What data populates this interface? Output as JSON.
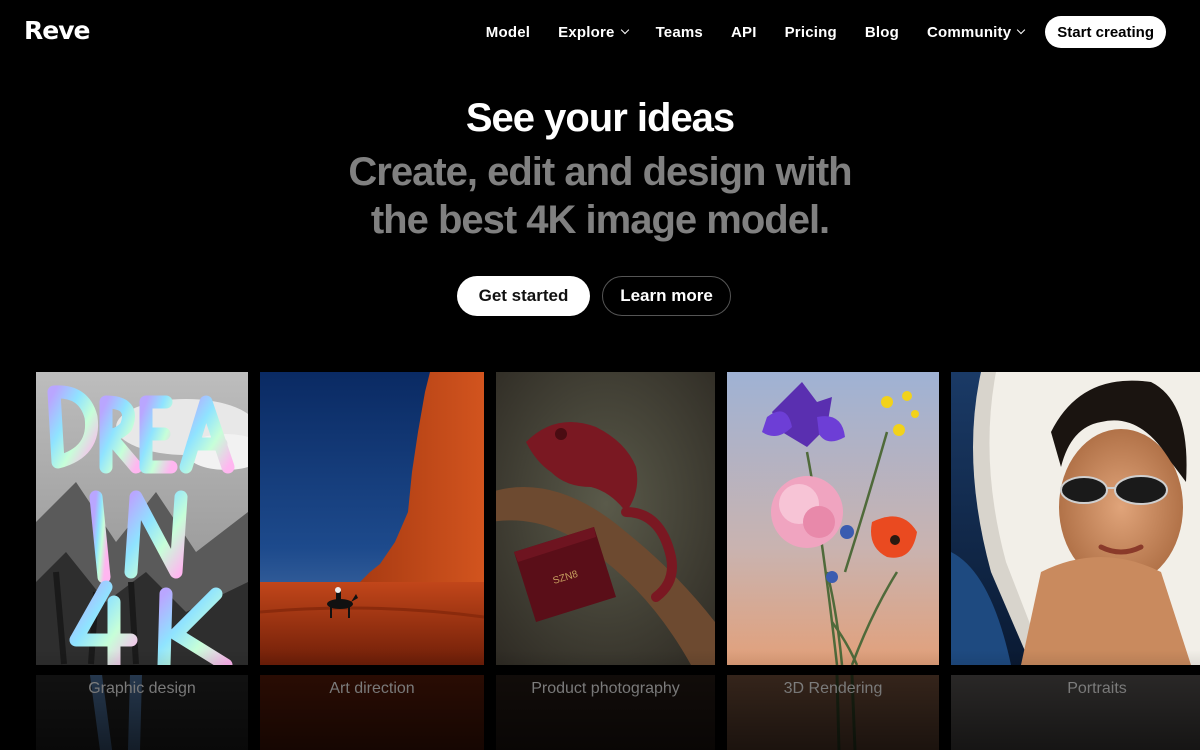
{
  "brand": {
    "logo": "Reve"
  },
  "nav": {
    "items": [
      {
        "label": "Model",
        "dropdown": false
      },
      {
        "label": "Explore",
        "dropdown": true
      },
      {
        "label": "Teams",
        "dropdown": false
      },
      {
        "label": "API",
        "dropdown": false
      },
      {
        "label": "Pricing",
        "dropdown": false
      },
      {
        "label": "Blog",
        "dropdown": false
      },
      {
        "label": "Community",
        "dropdown": true
      }
    ],
    "cta": "Start creating"
  },
  "hero": {
    "title": "See your ideas",
    "subtitle_line1": "Create, edit and design with",
    "subtitle_line2": "the best 4K image model.",
    "primary_button": "Get started",
    "secondary_button": "Learn more"
  },
  "gallery": [
    {
      "caption": "Graphic design",
      "image": "dream-in-4k-lettering"
    },
    {
      "caption": "Art direction",
      "image": "desert-horse-rider"
    },
    {
      "caption": "Product photography",
      "image": "chameleon-with-bag"
    },
    {
      "caption": "3D Rendering",
      "image": "flower-bouquet"
    },
    {
      "caption": "Portraits",
      "image": "woman-in-car-sunglasses"
    }
  ],
  "colors": {
    "background": "#000000",
    "text": "#ffffff",
    "subtitle": "#808080",
    "caption": "#9a9a9a"
  }
}
